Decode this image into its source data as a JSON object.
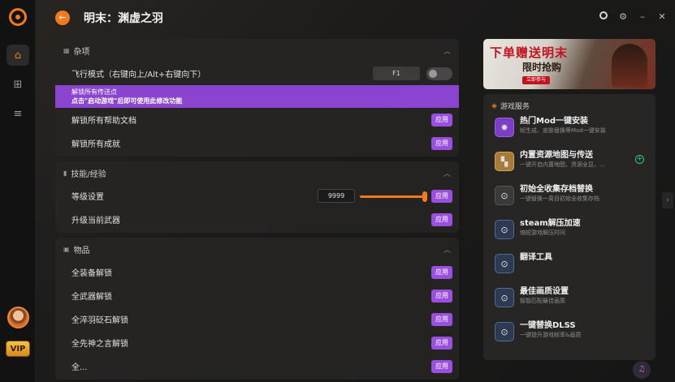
{
  "window": {
    "title": "明末：渊虚之羽",
    "back_label": "←"
  },
  "sidebar": {
    "vip_label": "VIP"
  },
  "sections": [
    {
      "title": "杂项",
      "icon": "grid-icon"
    },
    {
      "title": "技能/经验",
      "icon": "bars-icon"
    },
    {
      "title": "物品",
      "icon": "box-icon"
    }
  ],
  "misc": {
    "fly_label": "飞行模式（右键向上/Alt+右键向下）",
    "fly_hotkey": "F1",
    "banner_line1": "解锁所有传送点",
    "banner_line2": "点击\"启动游戏\"后即可使用此修改功能",
    "unlock_docs": "解锁所有帮助文档",
    "unlock_achievements": "解锁所有成就"
  },
  "skill": {
    "level_label": "等级设置",
    "level_value": "9999",
    "level_slider_fraction": 1.0,
    "upgrade_weapon": "升级当前武器"
  },
  "items": [
    {
      "label": "全装备解锁"
    },
    {
      "label": "全武器解锁"
    },
    {
      "label": "全淬羽砭石解锁"
    },
    {
      "label": "全先神之言解锁"
    },
    {
      "label": "全..."
    }
  ],
  "apply_label": "应用",
  "ad": {
    "title": "下单赠送明末",
    "subtitle": "限时抢购",
    "tag": "立即参与"
  },
  "services_header": "游戏服务",
  "services": [
    {
      "title": "热门Mod一键安装",
      "desc": "帧生成、皮肤替换等Mod一键安装",
      "icon": "mod-icon",
      "variant": "purple"
    },
    {
      "title": "内置资源地图与传送",
      "desc": "一键开启内置地图，资源全显，…",
      "icon": "map-icon",
      "variant": "gold"
    },
    {
      "title": "初始全收集存档替换",
      "desc": "一键替换一周目初始全收集存档",
      "icon": "download-icon",
      "variant": "dark"
    },
    {
      "title": "steam解压加速",
      "desc": "缩短游戏解压时间",
      "icon": "download-icon",
      "variant": "blue"
    },
    {
      "title": "翻译工具",
      "desc": "",
      "icon": "download-icon",
      "variant": "blue"
    },
    {
      "title": "最佳画质设置",
      "desc": "智能匹配最佳画质",
      "icon": "download-icon",
      "variant": "blue"
    },
    {
      "title": "一键替换DLSS",
      "desc": "一键提升游戏帧率&画质",
      "icon": "download-icon",
      "variant": "blue"
    }
  ],
  "colors": {
    "accent": "#f07a22",
    "apply": "#9b4fe0",
    "banner": "#8a44cf",
    "plus": "#2ecc71"
  }
}
